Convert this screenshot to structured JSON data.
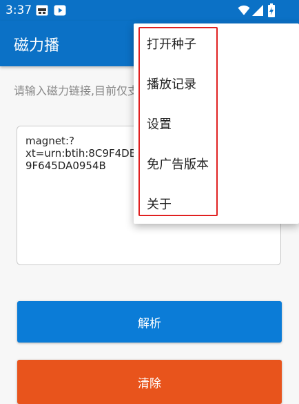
{
  "status_bar": {
    "time": "3:37",
    "icons": [
      "app-notification-icon",
      "youtube-icon",
      "wifi-icon",
      "cell-signal-icon",
      "battery-charging-icon"
    ]
  },
  "toolbar": {
    "title": "磁力播"
  },
  "main": {
    "hint": "请输入磁力链接,目前仅支",
    "magnet_value": "magnet:?\nxt=urn:btih:8C9F4DB\n9F645DA0954B",
    "parse_label": "解析",
    "clear_label": "清除"
  },
  "menu": {
    "items": [
      {
        "label": "打开种子"
      },
      {
        "label": "播放记录"
      },
      {
        "label": "设置"
      },
      {
        "label": "免广告版本"
      },
      {
        "label": "关于"
      }
    ]
  },
  "colors": {
    "primary": "#0b71c6",
    "parse_button": "#0b7cd7",
    "clear_button": "#e8541c",
    "highlight_border": "#e02020"
  }
}
